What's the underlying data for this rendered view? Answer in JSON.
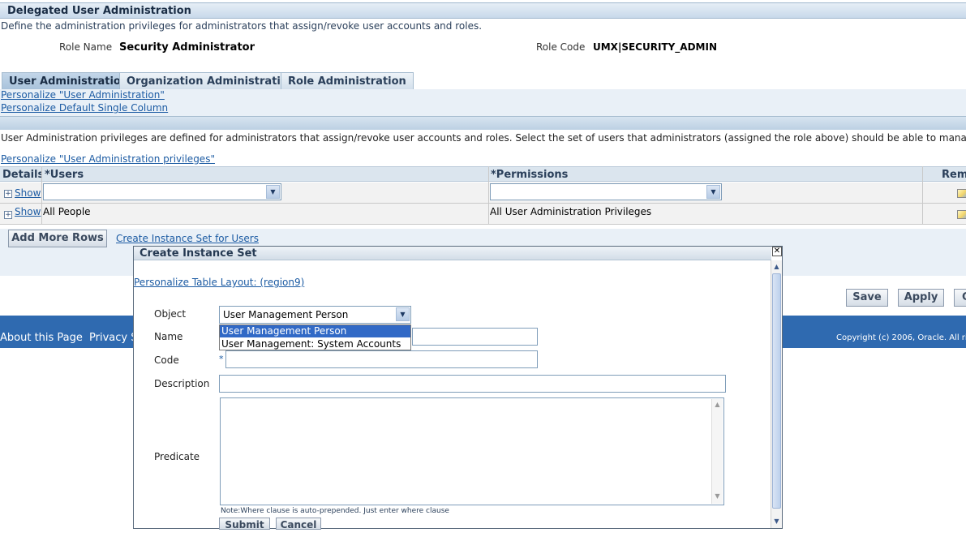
{
  "header": {
    "title": "Delegated User Administration",
    "description": "Define the administration privileges for administrators that assign/revoke user accounts and roles."
  },
  "role": {
    "name_label": "Role Name",
    "name_value": "Security Administrator",
    "code_label": "Role Code",
    "code_value": "UMX|SECURITY_ADMIN"
  },
  "tabs": [
    {
      "label": "User Administration"
    },
    {
      "label": "Organization Administration"
    },
    {
      "label": "Role Administration"
    }
  ],
  "personalize_links": {
    "user_admin": "Personalize \"User Administration\"",
    "single_column": "Personalize Default Single Column",
    "privileges": "Personalize \"User Administration privileges\""
  },
  "section_text": "User Administration privileges are defined for administrators that assign/revoke user accounts and roles. Select the set of users that administrators (assigned the role above) should be able to manage.",
  "table": {
    "headers": [
      "Details",
      "*Users",
      "*Permissions",
      "Rem"
    ],
    "rows": [
      {
        "details": "Show",
        "users": "",
        "permissions": ""
      },
      {
        "details": "Show",
        "users": "All People",
        "permissions": "All User Administration Privileges"
      }
    ]
  },
  "actions": {
    "add_rows": "Add More Rows",
    "create_instance_set": "Create Instance Set for Users",
    "save": "Save",
    "apply": "Apply",
    "cancel_partial": "C"
  },
  "footer": {
    "about": "About this Page",
    "privacy": "Privacy S",
    "copyright": "Copyright (c) 2006, Oracle. All rig"
  },
  "modal": {
    "title": "Create Instance Set",
    "personalize_link": "Personalize Table Layout: (region9)",
    "object_label": "Object",
    "object_value": "User Management Person",
    "object_options": [
      "User Management Person",
      "User Management: System Accounts"
    ],
    "name_label": "Name",
    "code_label": "Code",
    "required_marker": "*",
    "description_label": "Description",
    "predicate_label": "Predicate",
    "note": "Note:Where clause is auto-prepended. Just enter where clause",
    "submit": "Submit",
    "cancel": "Cancel"
  },
  "colors": {
    "link": "#1c5ba3",
    "footer": "#2f6ab0",
    "selection": "#3169c6"
  }
}
